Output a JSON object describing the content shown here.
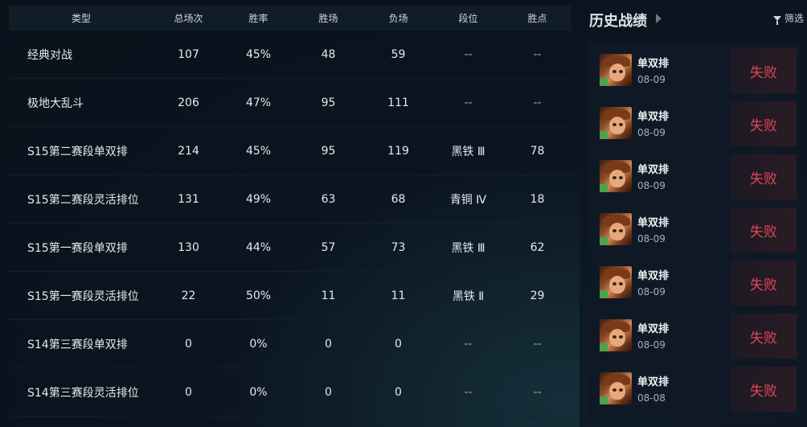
{
  "stats": {
    "headers": [
      "类型",
      "总场次",
      "胜率",
      "胜场",
      "负场",
      "段位",
      "胜点"
    ],
    "rows": [
      [
        "经典对战",
        "107",
        "45%",
        "48",
        "59",
        "--",
        "--"
      ],
      [
        "极地大乱斗",
        "206",
        "47%",
        "95",
        "111",
        "--",
        "--"
      ],
      [
        "S15第二赛段单双排",
        "214",
        "45%",
        "95",
        "119",
        "黑铁 Ⅲ",
        "78"
      ],
      [
        "S15第二赛段灵活排位",
        "131",
        "49%",
        "63",
        "68",
        "青铜 Ⅳ",
        "18"
      ],
      [
        "S15第一赛段单双排",
        "130",
        "44%",
        "57",
        "73",
        "黑铁 Ⅲ",
        "62"
      ],
      [
        "S15第一赛段灵活排位",
        "22",
        "50%",
        "11",
        "11",
        "黑铁 Ⅱ",
        "29"
      ],
      [
        "S14第三赛段单双排",
        "0",
        "0%",
        "0",
        "0",
        "--",
        "--"
      ],
      [
        "S14第三赛段灵活排位",
        "0",
        "0%",
        "0",
        "0",
        "--",
        "--"
      ]
    ]
  },
  "history": {
    "title": "历史战绩",
    "filter_label": "筛选",
    "matches": [
      {
        "mode": "单双排",
        "date": "08-09",
        "result": "失败"
      },
      {
        "mode": "单双排",
        "date": "08-09",
        "result": "失败"
      },
      {
        "mode": "单双排",
        "date": "08-09",
        "result": "失败"
      },
      {
        "mode": "单双排",
        "date": "08-09",
        "result": "失败"
      },
      {
        "mode": "单双排",
        "date": "08-09",
        "result": "失败"
      },
      {
        "mode": "单双排",
        "date": "08-09",
        "result": "失败"
      },
      {
        "mode": "单双排",
        "date": "08-08",
        "result": "失败"
      }
    ]
  },
  "colors": {
    "loss": "#e2455a",
    "level_badge": "#4aa34a"
  }
}
